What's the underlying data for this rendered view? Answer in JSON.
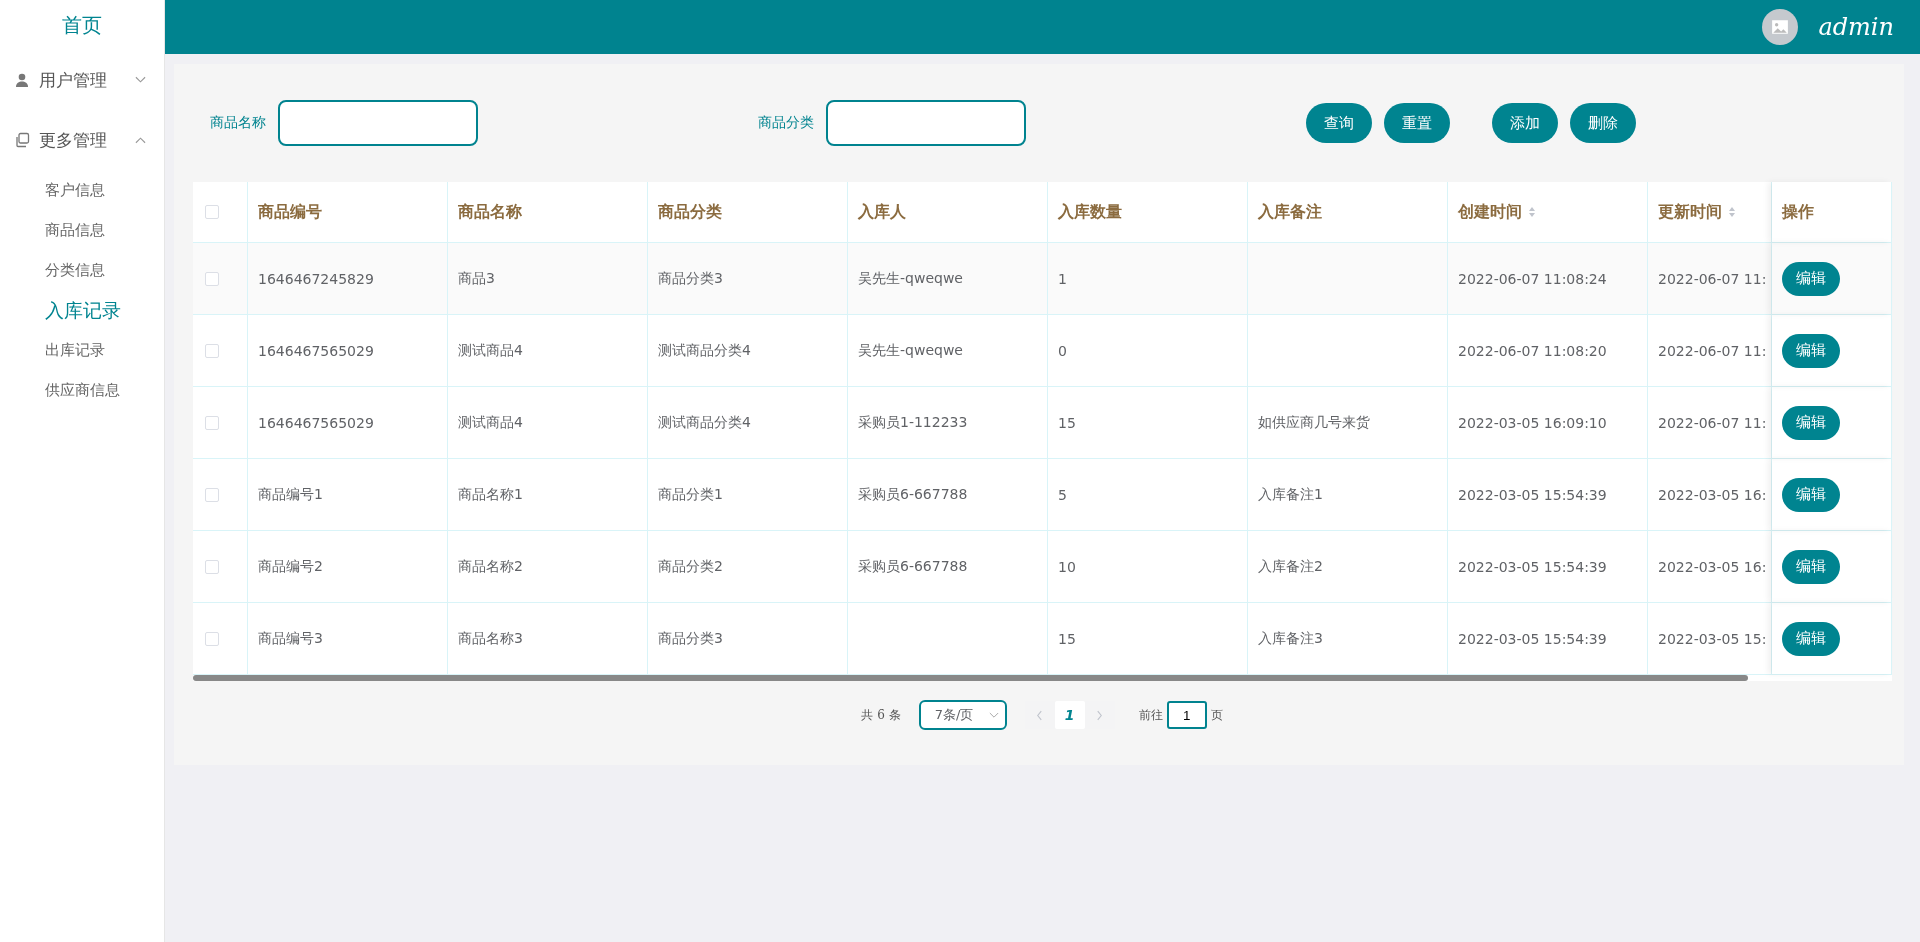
{
  "sidebar": {
    "home": "首页",
    "groups": [
      {
        "label": "用户管理",
        "expanded": false
      },
      {
        "label": "更多管理",
        "expanded": true,
        "children": [
          {
            "label": "客户信息",
            "selected": false
          },
          {
            "label": "商品信息",
            "selected": false
          },
          {
            "label": "分类信息",
            "selected": false
          },
          {
            "label": "入库记录",
            "selected": true
          },
          {
            "label": "出库记录",
            "selected": false
          },
          {
            "label": "供应商信息",
            "selected": false
          }
        ]
      }
    ]
  },
  "header": {
    "username": "admin"
  },
  "search": {
    "fields": [
      {
        "label": "商品名称"
      },
      {
        "label": "商品分类"
      }
    ],
    "buttons": [
      "查询",
      "重置",
      "添加",
      "删除"
    ]
  },
  "table": {
    "select_all_checked": false,
    "columns": [
      {
        "label": "商品编号",
        "sortable": false
      },
      {
        "label": "商品名称",
        "sortable": false
      },
      {
        "label": "商品分类",
        "sortable": false
      },
      {
        "label": "入库人",
        "sortable": false
      },
      {
        "label": "入库数量",
        "sortable": false
      },
      {
        "label": "入库备注",
        "sortable": false
      },
      {
        "label": "创建时间",
        "sortable": true
      },
      {
        "label": "更新时间",
        "sortable": true
      },
      {
        "label": "操作",
        "sortable": false
      }
    ],
    "rows": [
      {
        "checked": false,
        "cells": [
          "1646467245829",
          "商品3",
          "商品分类3",
          "吴先生-qweqwe",
          "1",
          "",
          "2022-06-07 11:08:24",
          "2022-06-07 11:"
        ],
        "action": "编辑"
      },
      {
        "checked": false,
        "cells": [
          "1646467565029",
          "测试商品4",
          "测试商品分类4",
          "吴先生-qweqwe",
          "0",
          "",
          "2022-06-07 11:08:20",
          "2022-06-07 11:"
        ],
        "action": "编辑"
      },
      {
        "checked": false,
        "cells": [
          "1646467565029",
          "测试商品4",
          "测试商品分类4",
          "采购员1-112233",
          "15",
          "如供应商几号来货",
          "2022-03-05 16:09:10",
          "2022-06-07 11:"
        ],
        "action": "编辑"
      },
      {
        "checked": false,
        "cells": [
          "商品编号1",
          "商品名称1",
          "商品分类1",
          "采购员6-667788",
          "5",
          "入库备注1",
          "2022-03-05 15:54:39",
          "2022-03-05 16:"
        ],
        "action": "编辑"
      },
      {
        "checked": false,
        "cells": [
          "商品编号2",
          "商品名称2",
          "商品分类2",
          "采购员6-667788",
          "10",
          "入库备注2",
          "2022-03-05 15:54:39",
          "2022-03-05 16:"
        ],
        "action": "编辑"
      },
      {
        "checked": false,
        "cells": [
          "商品编号3",
          "商品名称3",
          "商品分类3",
          "",
          "15",
          "入库备注3",
          "2022-03-05 15:54:39",
          "2022-03-05 15:"
        ],
        "action": "编辑"
      }
    ]
  },
  "pagination": {
    "total": "共 6 条",
    "page_size": "7条/页",
    "pages": [
      {
        "label": "1",
        "selected": true
      }
    ],
    "goto_label": "前往",
    "goto_value": "1",
    "goto_suffix": "页"
  }
}
